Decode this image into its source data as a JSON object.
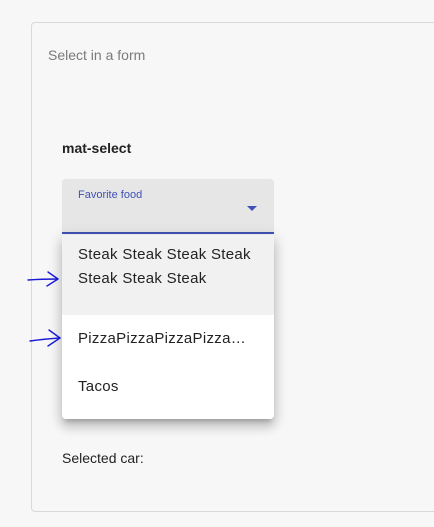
{
  "card": {
    "header": "Select in a form"
  },
  "section": {
    "title": "mat-select"
  },
  "select": {
    "label": "Favorite food",
    "accent_color": "#3f51b5",
    "options": [
      {
        "label": "Steak Steak Steak Steak Steak Steak Steak"
      },
      {
        "label": "PizzaPizzaPizzaPizza…"
      },
      {
        "label": "Tacos"
      }
    ]
  },
  "footer": {
    "selected_car_label": "Selected car:"
  },
  "annotations": {
    "arrow_color": "#1a1ad6",
    "icons": [
      "hand-drawn-arrow-icon",
      "hand-drawn-arrow-icon"
    ]
  }
}
